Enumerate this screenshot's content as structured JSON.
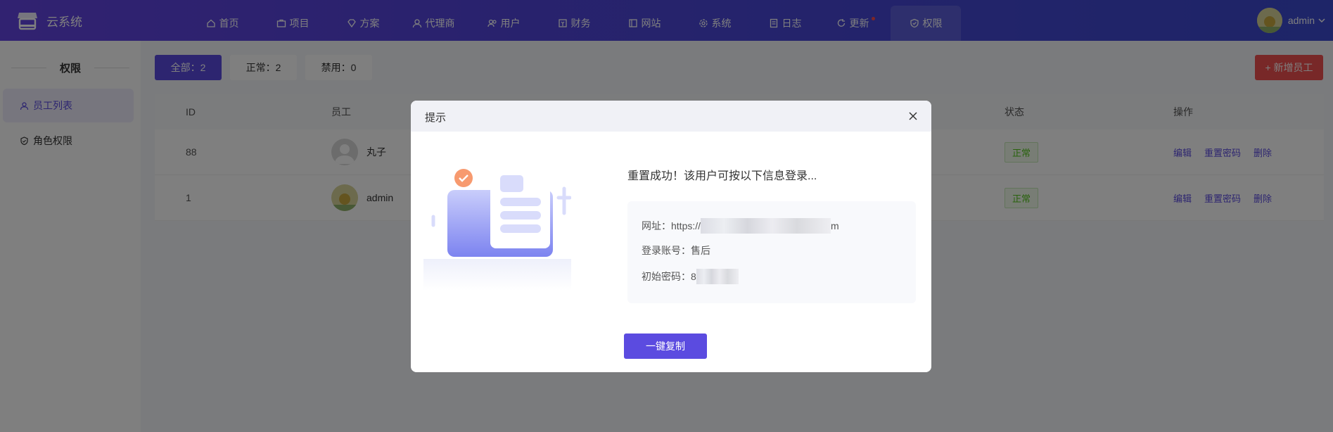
{
  "app": {
    "title": "云系统"
  },
  "nav": {
    "items": [
      {
        "label": "首页",
        "icon": "home-icon"
      },
      {
        "label": "项目",
        "icon": "briefcase-icon"
      },
      {
        "label": "方案",
        "icon": "diamond-icon"
      },
      {
        "label": "代理商",
        "icon": "agent-icon"
      },
      {
        "label": "用户",
        "icon": "users-icon"
      },
      {
        "label": "财务",
        "icon": "finance-icon"
      },
      {
        "label": "网站",
        "icon": "website-icon"
      },
      {
        "label": "系统",
        "icon": "settings-icon"
      },
      {
        "label": "日志",
        "icon": "log-icon"
      },
      {
        "label": "更新",
        "icon": "refresh-icon"
      },
      {
        "label": "权限",
        "icon": "shield-icon"
      }
    ],
    "active": "权限",
    "user_name": "admin"
  },
  "sidebar": {
    "title": "权限",
    "items": [
      {
        "label": "员工列表",
        "active": true
      },
      {
        "label": "角色权限",
        "active": false
      }
    ]
  },
  "filters": {
    "all": "全部：2",
    "normal": "正常：2",
    "disabled": "禁用：0"
  },
  "actions": {
    "add_staff": "+ 新增员工"
  },
  "table": {
    "headers": {
      "id": "ID",
      "staff": "员工",
      "status": "状态",
      "ops": "操作"
    },
    "rows": [
      {
        "id": "88",
        "name": "丸子",
        "status": "正常",
        "ops": [
          "编辑",
          "重置密码",
          "删除"
        ]
      },
      {
        "id": "1",
        "name": "admin",
        "status": "正常",
        "ops": [
          "编辑",
          "重置密码",
          "删除"
        ]
      }
    ]
  },
  "modal": {
    "title": "提示",
    "message": "重置成功！该用户可按以下信息登录...",
    "url_label": "网址：",
    "url_prefix": "https://",
    "url_suffix": "m",
    "account_label": "登录账号：",
    "account_value": "售后",
    "password_label": "初始密码：",
    "password_prefix": "8",
    "copy_button": "一键复制"
  },
  "colors": {
    "accent": "#5b4be0",
    "danger": "#f05050",
    "success": "#52c41a"
  }
}
